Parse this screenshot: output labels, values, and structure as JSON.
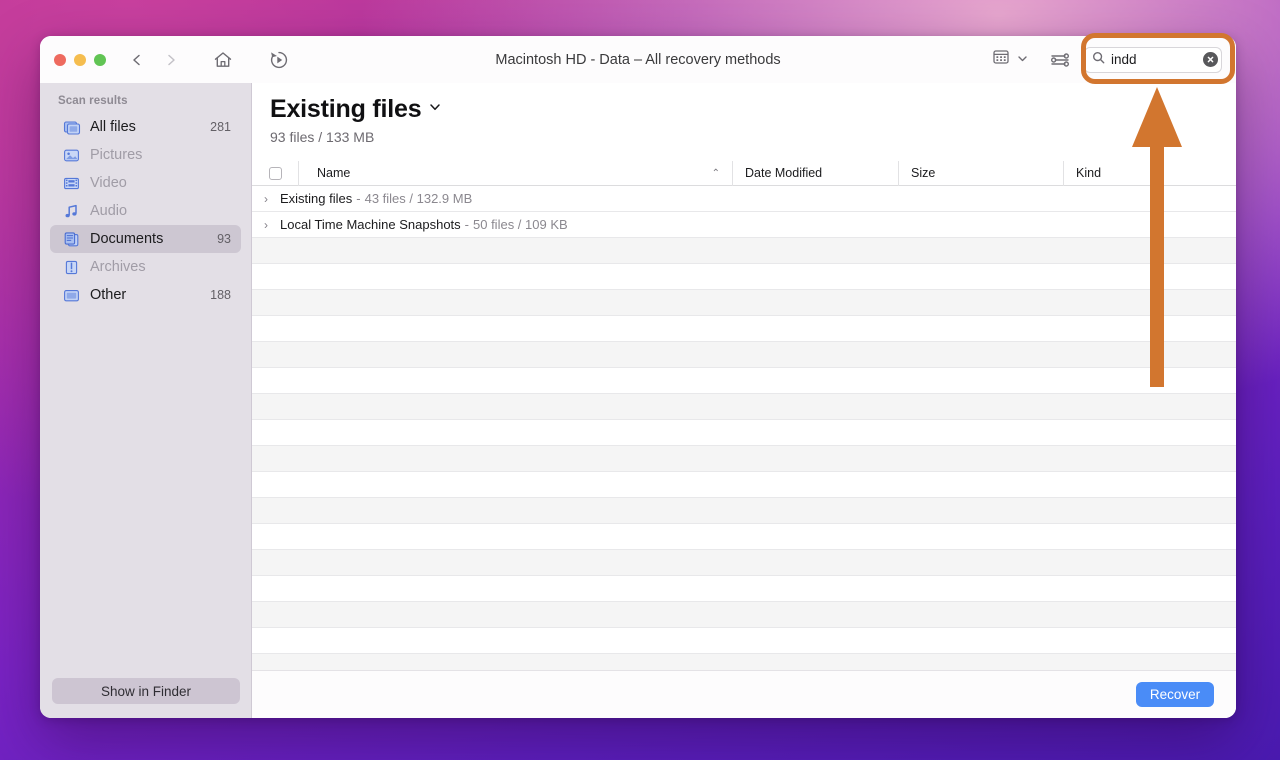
{
  "window": {
    "title": "Macintosh HD - Data – All recovery methods"
  },
  "toolbar": {
    "back_icon": "chevron-left-icon",
    "forward_icon": "chevron-right-icon",
    "home_icon": "home-icon",
    "restore_icon": "rewind-play-icon",
    "view_mode_icon": "gallery-view-icon",
    "view_mode_chevron": "chevron-down-icon",
    "filter_icon": "sliders-icon",
    "search": {
      "icon": "search-icon",
      "value": "indd",
      "placeholder": "Search",
      "clear_icon": "clear-circle-icon"
    }
  },
  "sidebar": {
    "header": "Scan results",
    "items": [
      {
        "label": "All files",
        "count": "281",
        "icon": "stacked-files-icon",
        "enabled": true,
        "selected": false
      },
      {
        "label": "Pictures",
        "count": "",
        "icon": "picture-icon",
        "enabled": false,
        "selected": false
      },
      {
        "label": "Video",
        "count": "",
        "icon": "film-icon",
        "enabled": false,
        "selected": false
      },
      {
        "label": "Audio",
        "count": "",
        "icon": "music-note-icon",
        "enabled": false,
        "selected": false
      },
      {
        "label": "Documents",
        "count": "93",
        "icon": "documents-icon",
        "enabled": true,
        "selected": true
      },
      {
        "label": "Archives",
        "count": "",
        "icon": "archive-icon",
        "enabled": false,
        "selected": false
      },
      {
        "label": "Other",
        "count": "188",
        "icon": "other-files-icon",
        "enabled": true,
        "selected": false
      }
    ],
    "show_in_finder_label": "Show in Finder"
  },
  "main": {
    "section_title": "Existing files",
    "section_chevron": "chevron-down-icon",
    "section_subtitle": "93 files / 133 MB",
    "columns": {
      "name": "Name",
      "date_modified": "Date Modified",
      "size": "Size",
      "kind": "Kind",
      "sort_caret": "⌃"
    },
    "rows": [
      {
        "name": "Existing files",
        "separator": "-",
        "meta": "43 files / 132.9 MB"
      },
      {
        "name": "Local Time Machine Snapshots",
        "separator": "-",
        "meta": "50 files / 109 KB"
      }
    ],
    "empty_row_count": 18,
    "recover_label": "Recover"
  },
  "annotations": {
    "highlight_color": "#d2762f",
    "box_target": "search-field",
    "arrow_direction": "up"
  }
}
